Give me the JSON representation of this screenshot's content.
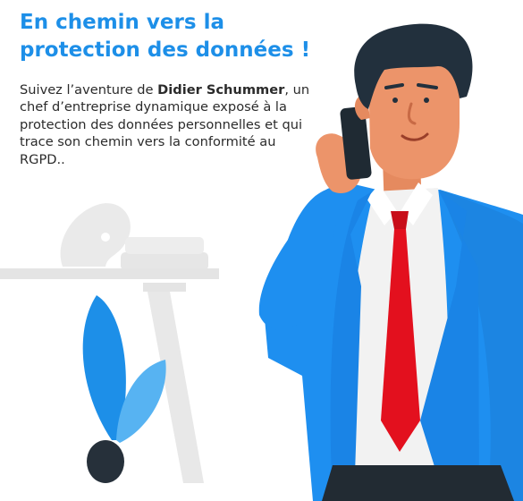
{
  "header": {
    "title_line1": "En chemin vers la",
    "title_line2": "protection des données !",
    "title_color": "#1d8fe8"
  },
  "intro": {
    "before": "Suivez l’aventure de ",
    "name": "Didier Schummer",
    "after": ", un chef d’entreprise dynamique exposé à la protection des données personnelles et qui trace son chemin vers la conformité au RGPD.."
  },
  "illustration": {
    "subject": "businessman-on-phone",
    "jacket_color": "#1e8ff0",
    "tie_color": "#e3101e",
    "skin_color": "#ec946a",
    "hair_color": "#22303d"
  }
}
